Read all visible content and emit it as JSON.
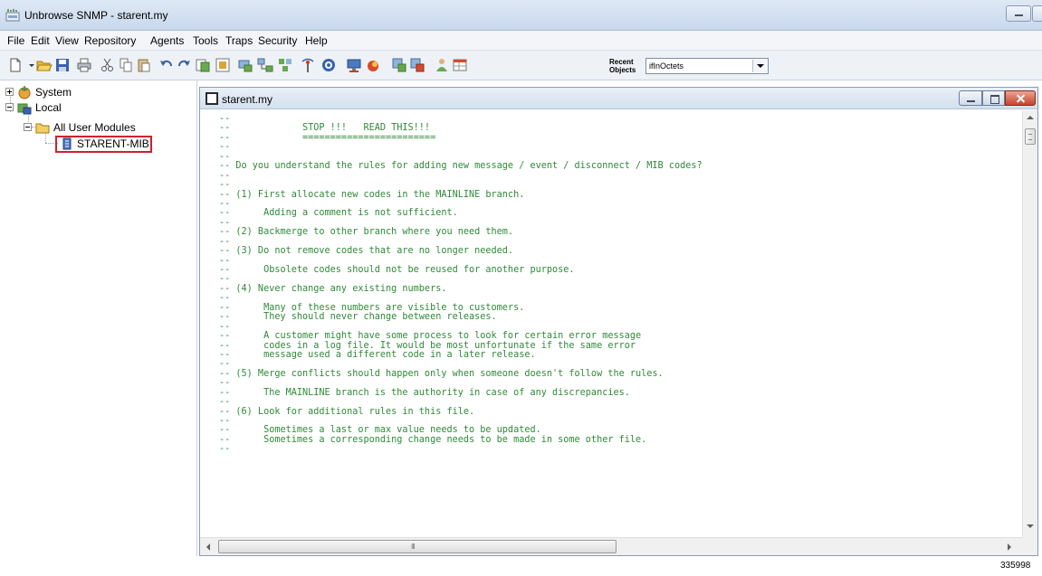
{
  "window": {
    "title": "Unbrowse SNMP - starent.my"
  },
  "menu": [
    "File",
    "Edit",
    "View",
    "Repository",
    "Agents",
    "Tools",
    "Traps",
    "Security",
    "Help"
  ],
  "toolbar": {
    "icons": [
      "new-icon",
      "open-icon",
      "save-icon",
      "print-icon",
      "cut-icon",
      "copy-icon",
      "paste-icon",
      "undo-icon",
      "redo-icon",
      "load-mib-icon",
      "compile-icon",
      "agent-icon",
      "network-icon",
      "discover-icon",
      "antenna-icon",
      "help-icon",
      "monitor-icon",
      "trap-icon",
      "walk-icon",
      "set-icon",
      "users-icon",
      "table-icon"
    ],
    "recent_label_line1": "Recent",
    "recent_label_line2": "Objects",
    "recent_value": "ifInOctets"
  },
  "tree": {
    "system": "System",
    "local": "Local",
    "all_user_modules": "All User Modules",
    "starent_mib": "STARENT-MIB"
  },
  "document": {
    "title": "starent.my",
    "lines": [
      "--",
      "--             STOP !!!   READ THIS!!!",
      "--             ========================",
      "--",
      "--",
      "-- Do you understand the rules for adding new message / event / disconnect / MIB codes?",
      "--",
      "--",
      "-- (1) First allocate new codes in the MAINLINE branch.",
      "--",
      "--      Adding a comment is not sufficient.",
      "--",
      "-- (2) Backmerge to other branch where you need them.",
      "--",
      "-- (3) Do not remove codes that are no longer needed.",
      "--",
      "--      Obsolete codes should not be reused for another purpose.",
      "--",
      "-- (4) Never change any existing numbers.",
      "--",
      "--      Many of these numbers are visible to customers.",
      "--      They should never change between releases.",
      "--",
      "--      A customer might have some process to look for certain error message",
      "--      codes in a log file. It would be most unfortunate if the same error",
      "--      message used a different code in a later release.",
      "--",
      "-- (5) Merge conflicts should happen only when someone doesn't follow the rules.",
      "--",
      "--      The MAINLINE branch is the authority in case of any discrepancies.",
      "--",
      "-- (6) Look for additional rules in this file.",
      "--",
      "--      Sometimes a last or max value needs to be updated.",
      "--      Sometimes a corresponding change needs to be made in some other file.",
      "--"
    ]
  },
  "scrollbar": {
    "grip": "III"
  },
  "figure_id": "335998"
}
